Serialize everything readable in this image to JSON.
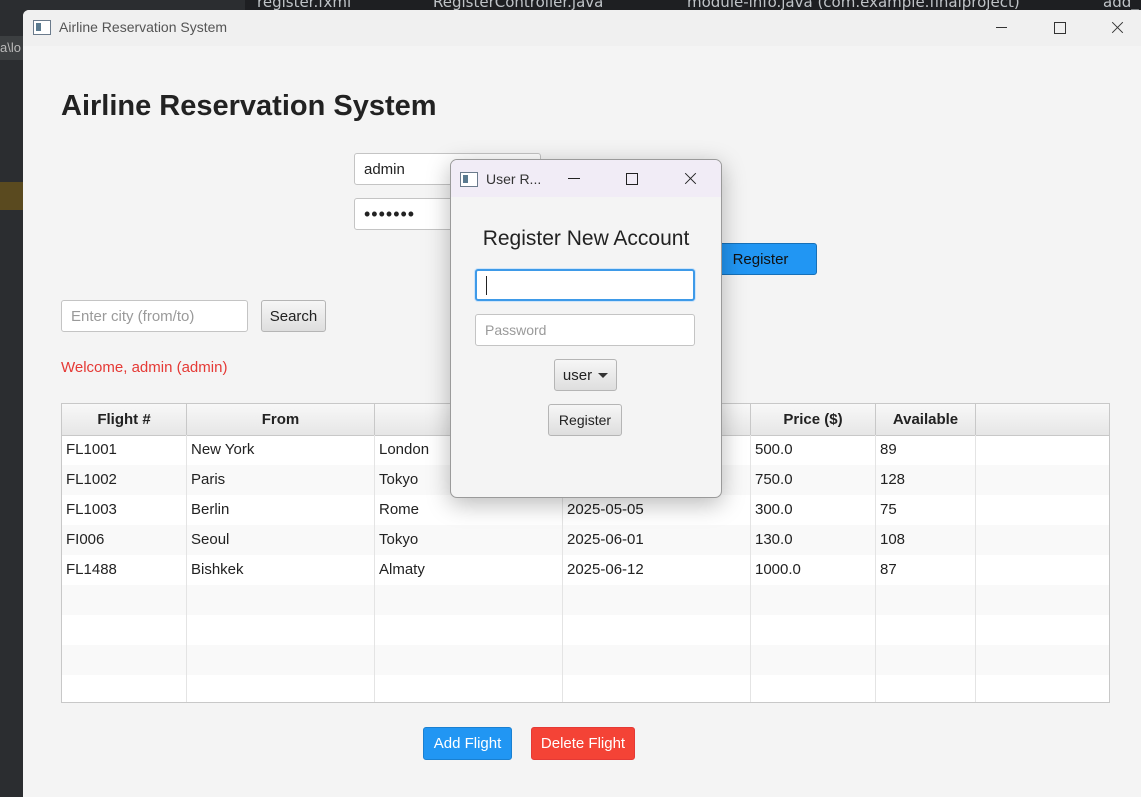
{
  "ide": {
    "tabs": [
      "register.fxml",
      "RegisterController.java",
      "module-info.java (com.example.finalproject)",
      "add_"
    ],
    "path_fragment": "a\\lo"
  },
  "window": {
    "title": "Airline Reservation System"
  },
  "page": {
    "title": "Airline Reservation System"
  },
  "login": {
    "username_value": "admin",
    "password_mask": "•••••••",
    "register_label": "Register"
  },
  "search": {
    "placeholder": "Enter city (from/to)",
    "button_label": "Search"
  },
  "welcome_text": "Welcome, admin (admin)",
  "table": {
    "columns": [
      "Flight #",
      "From",
      "To",
      "Date",
      "Price ($)",
      "Available"
    ],
    "rows": [
      [
        "FL1001",
        "New York",
        "London",
        "",
        "500.0",
        "89"
      ],
      [
        "FL1002",
        "Paris",
        "Tokyo",
        "",
        "750.0",
        "128"
      ],
      [
        "FL1003",
        "Berlin",
        "Rome",
        "2025-05-05",
        "300.0",
        "75"
      ],
      [
        "FI006",
        "Seoul",
        "Tokyo",
        "2025-06-01",
        "130.0",
        "108"
      ],
      [
        "FL1488",
        "Bishkek",
        "Almaty",
        "2025-06-12",
        "1000.0",
        "87"
      ]
    ]
  },
  "actions": {
    "add_label": "Add Flight",
    "delete_label": "Delete Flight"
  },
  "dialog": {
    "title": "User R...",
    "heading": "Register New Account",
    "username_value": "",
    "password_placeholder": "Password",
    "role_value": "user",
    "register_label": "Register"
  },
  "colors": {
    "accent_blue": "#2196f3",
    "danger_red": "#f44336",
    "welcome_red": "#e53935"
  }
}
